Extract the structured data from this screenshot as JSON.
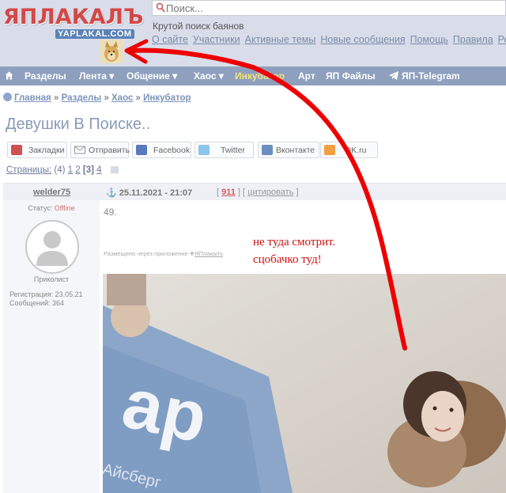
{
  "header": {
    "logo_main": "ЯПЛАКАЛЪ",
    "logo_sub": "YAPLAKAL.COM",
    "search_placeholder": "Поиск...",
    "tagline": "Крутой поиск баянов",
    "links": [
      "О сайте",
      "Участники",
      "Активные темы",
      "Новые сообщения",
      "Помощь",
      "Правила",
      "Рек"
    ]
  },
  "nav": {
    "items": [
      "Разделы",
      "Лента ▾",
      "Общение ▾",
      "Хаос ▾",
      "Инкубатор",
      "Арт",
      "ЯП Файлы",
      "ЯП-Telegram"
    ]
  },
  "breadcrumb": {
    "items": [
      "Главная",
      "Разделы",
      "Хаос",
      "Инкубатор"
    ],
    "separator": "»"
  },
  "page_title": "Девушки В Поиске..",
  "share": [
    "Закладки",
    "Отправить",
    "Facebook",
    "Twitter",
    "Вконтакте",
    "OK.ru"
  ],
  "pagination": {
    "label": "Страницы:",
    "count": "(4)",
    "pages": [
      "1",
      "2",
      "[3]",
      "4"
    ]
  },
  "post": {
    "author": "welder75",
    "date": "25.11.2021 - 21:07",
    "rating": "911",
    "quote_label": "цитировать",
    "status_label": "Статус:",
    "status_value": "Offline",
    "rank": "Приколист",
    "registration": "Регистрация: 23.05.21",
    "messages": "Сообщений: 364",
    "number": "49.",
    "via_label": "Размещено через приложение",
    "via_app": "ЯПлакалъ"
  },
  "annotation": {
    "line1": "не туда смотрит.",
    "line2": "сцобачко туд!"
  },
  "colors": {
    "header_bg": "#d9dde9",
    "nav_bg": "#8ea0be",
    "link": "#7a8ba8",
    "annotation_red": "#cc1111"
  }
}
